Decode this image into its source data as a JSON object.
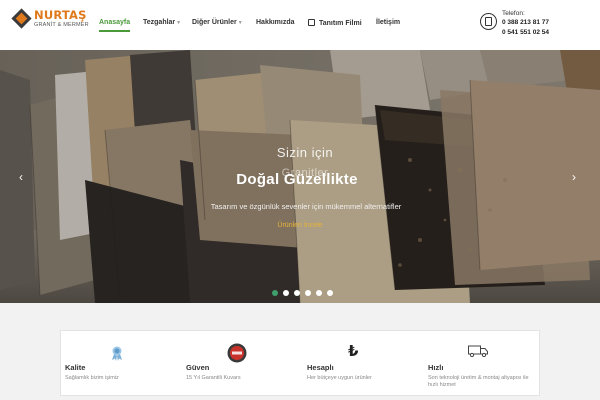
{
  "brand": {
    "name": "NURTAŞ",
    "tagline": "GRANİT & MERMER"
  },
  "nav": {
    "items": [
      {
        "label": "Anasayfa",
        "active": true
      },
      {
        "label": "Tezgahlar",
        "dropdown": true
      },
      {
        "label": "Diğer Ürünler",
        "dropdown": true
      },
      {
        "label": "Hakkımızda"
      },
      {
        "label": "Tanıtım Filmi",
        "icon": "film-icon"
      },
      {
        "label": "İletişim"
      }
    ]
  },
  "contact": {
    "label": "Telefon:",
    "phone1": "0 388 213 81 77",
    "phone2": "0 541 551 02 54",
    "icon": "phone-icon"
  },
  "hero": {
    "pretitle": "Sizin için",
    "pretitle_faded": "Granitler",
    "title": "Doğal Güzellikte",
    "description": "Tasarım ve özgünlük sevenler için mükemmel alternatifler",
    "link": "Ürünleri İncele",
    "slide_count": 6,
    "active_slide": 1
  },
  "features": [
    {
      "title": "Kalite",
      "desc": "Sağlamlık bizim işimiz",
      "icon": "award-ribbon-icon"
    },
    {
      "title": "Güven",
      "desc": "15 Yıl Garantili Kuvars",
      "icon": "guarantee-badge-icon"
    },
    {
      "title": "Hesaplı",
      "desc": "Her bütçeye uygun ürünler",
      "icon": "lira-icon"
    },
    {
      "title": "Hızlı",
      "desc": "Son teknoloji üretim & montaj altyapısı ile hızlı hizmet",
      "icon": "delivery-truck-icon"
    }
  ],
  "colors": {
    "accent": "#4a9a3a",
    "brand": "#e0791b",
    "link": "#e6b43a",
    "dot_active": "#3fa06e"
  }
}
